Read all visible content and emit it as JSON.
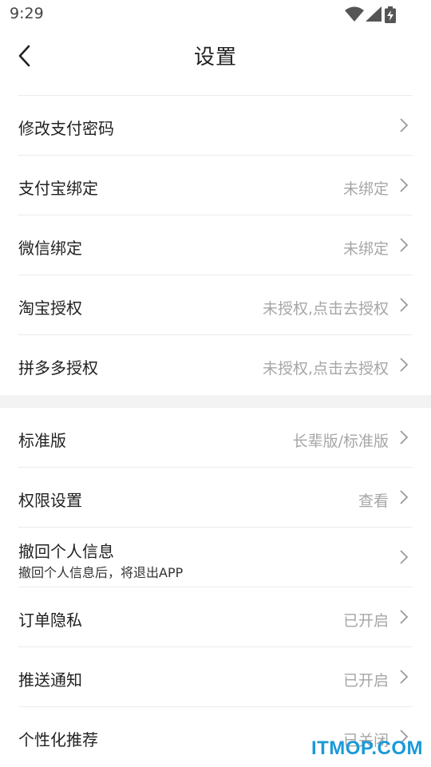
{
  "status_bar": {
    "time": "9:29",
    "icons": [
      "wifi-icon",
      "signal-icon",
      "battery-charging-icon"
    ]
  },
  "nav": {
    "title": "设置",
    "back_icon": "chevron-left-icon"
  },
  "section1": [
    {
      "label": "修改支付密码",
      "value": ""
    },
    {
      "label": "支付宝绑定",
      "value": "未绑定"
    },
    {
      "label": "微信绑定",
      "value": "未绑定"
    },
    {
      "label": "淘宝授权",
      "value": "未授权,点击去授权"
    },
    {
      "label": "拼多多授权",
      "value": "未授权,点击去授权"
    }
  ],
  "section2": [
    {
      "label": "标准版",
      "value": "长辈版/标准版"
    },
    {
      "label": "权限设置",
      "value": "查看"
    },
    {
      "label": "撤回个人信息",
      "desc": "撤回个人信息后，将退出APP",
      "value": ""
    },
    {
      "label": "订单隐私",
      "value": "已开启"
    },
    {
      "label": "推送通知",
      "value": "已开启"
    },
    {
      "label": "个性化推荐",
      "value": "已关闭"
    }
  ],
  "watermark": "ITMOP.COM",
  "colors": {
    "text": "#222222",
    "secondary": "#a6a6a6",
    "divider": "#ececec",
    "section_gap": "#f3f3f3",
    "watermark": "#1a9ad8"
  }
}
